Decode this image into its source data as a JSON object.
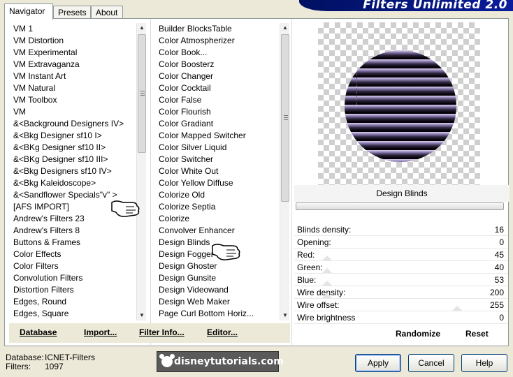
{
  "banner": {
    "title": "Filters Unlimited 2.0"
  },
  "tabs": [
    {
      "label": "Navigator",
      "active": true
    },
    {
      "label": "Presets",
      "active": false
    },
    {
      "label": "About",
      "active": false
    }
  ],
  "categories": [
    "VM 1",
    "VM Distortion",
    "VM Experimental",
    "VM Extravaganza",
    "VM Instant Art",
    "VM Natural",
    "VM Toolbox",
    "VM",
    "&<Background Designers IV>",
    "&<Bkg Designer sf10 I>",
    "&<BKg Designer sf10 II>",
    "&<BKg Designer sf10 III>",
    "&<Bkg Designers sf10 IV>",
    "&<Bkg Kaleidoscope>",
    "&<Sandflower Specials\"v\" >",
    "[AFS IMPORT]",
    "Andrew's Filters 23",
    "Andrew's Filters 8",
    "Buttons & Frames",
    "Color Effects",
    "Color Filters",
    "Convolution Filters",
    "Distortion Filters",
    "Edges, Round",
    "Edges, Square"
  ],
  "filters": [
    "Builder BlocksTable",
    "Color Atmospherizer",
    "Color Book...",
    "Color Boosterz",
    "Color Changer",
    "Color Cocktail",
    "Color False",
    "Color Flourish",
    "Color Gradiant",
    "Color Mapped Switcher",
    "Color Silver Liquid",
    "Color Switcher",
    "Color White Out",
    "Color Yellow Diffuse",
    "Colorize Old",
    "Colorize Septia",
    "Colorize",
    "Convolver Enhancer",
    "Design Blinds",
    "Design Fogger",
    "Design Ghoster",
    "Design Gunsite",
    "Design Videowand",
    "Design Web Maker",
    "Page Curl Bottom Horiz..."
  ],
  "toolbar": {
    "database": "Database",
    "import": "Import...",
    "filter_info": "Filter Info...",
    "editor": "Editor..."
  },
  "filter_title": "Design Blinds",
  "params": [
    {
      "name": "Blinds density:",
      "value": "16"
    },
    {
      "name": "Opening:",
      "value": "0"
    },
    {
      "name": "Red:",
      "value": "45"
    },
    {
      "name": "Green:",
      "value": "40"
    },
    {
      "name": "Blue:",
      "value": "53"
    },
    {
      "name": "Wire density:",
      "value": "200"
    },
    {
      "name": "Wire offset:",
      "value": "255"
    },
    {
      "name": "Wire brightness",
      "value": "0"
    }
  ],
  "actions": {
    "randomize": "Randomize",
    "reset": "Reset"
  },
  "footer": {
    "db_label": "Database:",
    "db_value": "ICNET-Filters",
    "filters_label": "Filters:",
    "filters_value": "1097"
  },
  "logo": {
    "text": "disneytutorials.com"
  },
  "buttons": {
    "apply": "Apply",
    "cancel": "Cancel",
    "help": "Help"
  },
  "icons": {
    "hand_pointer": "hand-pointer-icon",
    "scroll_up": "arrow-up-icon",
    "scroll_down": "arrow-down-icon"
  }
}
